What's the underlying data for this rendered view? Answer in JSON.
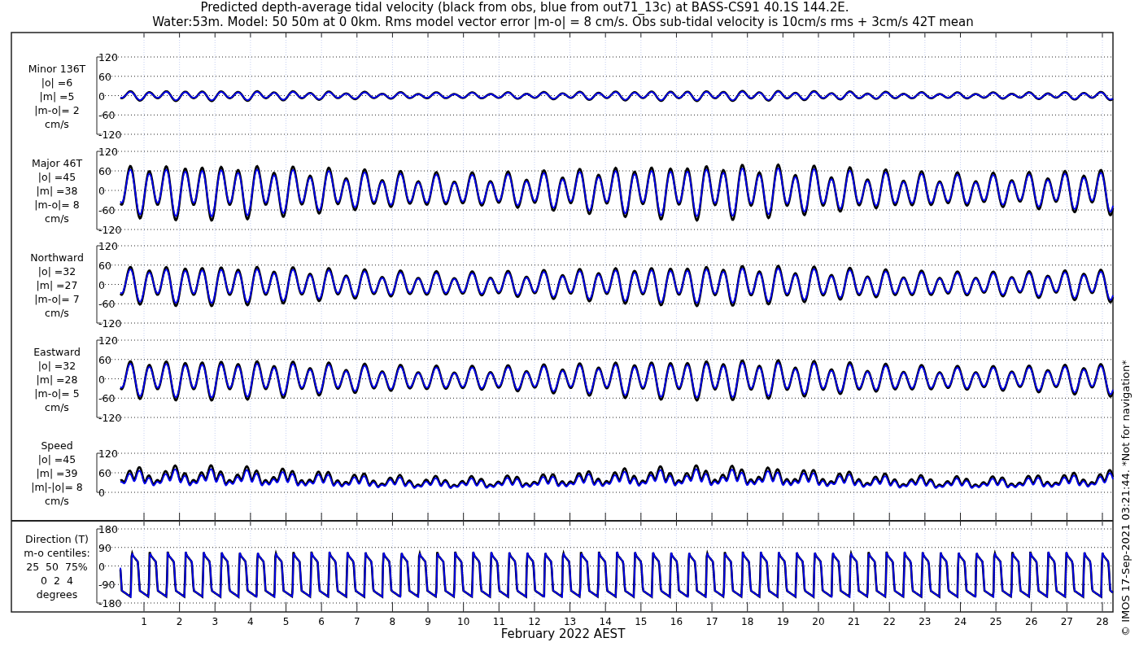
{
  "title": "Predicted depth-average tidal velocity (black from obs, blue from out71_13c) at BASS-CS91 40.1S 144.2E.",
  "subtitle": "Water:53m. Model: 50 50m at 0 0km. Rms model vector error |m-o| = 8 cm/s. Obs sub-tidal velocity is 10cm/s rms + 3cm/s 42T mean",
  "panels": [
    {
      "kind": "minor",
      "label": [
        "Minor 136T",
        "|o| =6",
        "|m| =5",
        "|m-o|= 2",
        "cm/s"
      ],
      "yticks": [
        "120",
        "60",
        "0",
        "-60",
        "-120"
      ]
    },
    {
      "kind": "major",
      "label": [
        "Major 46T",
        "|o| =45",
        "|m| =38",
        "|m-o|= 8",
        "cm/s"
      ],
      "yticks": [
        "120",
        "60",
        "0",
        "-60",
        "-120"
      ]
    },
    {
      "kind": "northward",
      "label": [
        "Northward",
        "|o| =32",
        "|m| =27",
        "|m-o|= 7",
        "cm/s"
      ],
      "yticks": [
        "120",
        "60",
        "0",
        "-60",
        "-120"
      ]
    },
    {
      "kind": "eastward",
      "label": [
        "Eastward",
        "|o| =32",
        "|m| =28",
        "|m-o|= 5",
        "cm/s"
      ],
      "yticks": [
        "120",
        "60",
        "0",
        "-60",
        "-120"
      ]
    },
    {
      "kind": "speed",
      "label": [
        "Speed",
        "|o| =45",
        "|m| =39",
        "|m|-|o|= 8",
        "cm/s"
      ],
      "yticks": [
        "120",
        "60",
        "0"
      ]
    },
    {
      "kind": "direction",
      "label": [
        "Direction (T)",
        "m-o centiles:",
        "25  50  75%",
        "0  2  4",
        "degrees"
      ],
      "yticks": [
        "180",
        "90",
        "0",
        "-90",
        "-180"
      ]
    }
  ],
  "xticks": [
    "1",
    "2",
    "3",
    "4",
    "5",
    "6",
    "7",
    "8",
    "9",
    "10",
    "11",
    "12",
    "13",
    "14",
    "15",
    "16",
    "17",
    "18",
    "19",
    "20",
    "21",
    "22",
    "23",
    "24",
    "25",
    "26",
    "27",
    "28"
  ],
  "xlabel": "February 2022 AEST",
  "footer": "© IMOS 17-Sep-2021 03:21:44. *Not for navigation*"
}
